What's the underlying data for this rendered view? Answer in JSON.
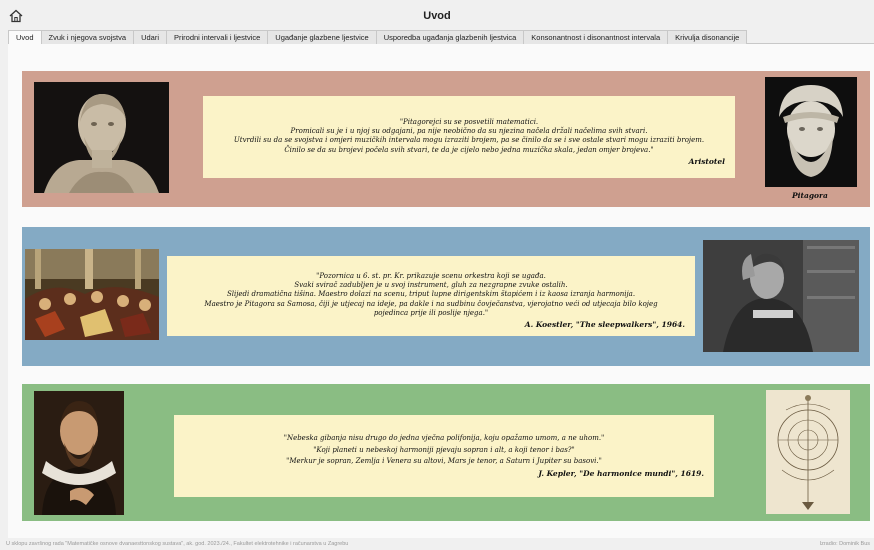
{
  "window": {
    "title": "Uvod"
  },
  "tabs": [
    {
      "label": "Uvod"
    },
    {
      "label": "Zvuk i njegova svojstva"
    },
    {
      "label": "Udari"
    },
    {
      "label": "Prirodni intervali i ljestvice"
    },
    {
      "label": "Ugađanje glazbene ljestvice"
    },
    {
      "label": "Usporedba ugađanja glazbenih ljestvica"
    },
    {
      "label": "Konsonantnost i disonantnost intervala"
    },
    {
      "label": "Krivulja disonancije"
    }
  ],
  "quotes": [
    {
      "lines": [
        "\"Pitagorejci su se posvetili matematici.",
        "Promicali su je i u njoj su odgajani, pa nije neobično da su njezina načela držali načelima svih stvari.",
        "Utvrdili su da se svojstva i omjeri muzičkih intervala mogu izraziti brojem, pa se činilo da se i sve ostale stvari mogu izraziti brojem.",
        "Činilo se da su brojevi počela svih stvari, te da je cijelo nebo jedna muzička skala, jedan omjer brojeva.\""
      ],
      "author": "Aristotel"
    },
    {
      "lines": [
        "\"Pozornica u 6. st. pr. Kr. prikazuje scenu orkestra koji se ugađa.",
        "Svaki svirač zadubljen je u svoj instrument, gluh za nezgrapne zvuke ostalih.",
        "Slijedi dramatična tišina. Maestro dolazi na scenu, triput lupne dirigentskim štapićem i iz kaosa izranja harmonija.",
        "Maestro je Pitagora sa Samosa, čiji je utjecaj na ideje, pa dakle i na sudbinu čovječanstva, vjerojatno veći od utjecaja bilo kojeg",
        "pojedinca prije ili poslije njega.\""
      ],
      "author": "A. Koestler, \"The sleepwalkers\", 1964."
    },
    {
      "lines": [
        "\"Nebeska gibanja nisu drugo do jedna vječna polifonija, koju opažamo umom, a ne uhom.\"",
        "\"Koji planeti u nebeskoj harmoniji pjevaju sopran i alt, a koji tenor i bas?\"",
        "\"Merkur je sopran, Zemlja i Venera su altovi, Mars je tenor, a Saturn i Jupiter su basovi.\""
      ],
      "author": "J. Kepler, \"De harmonice mundi\", 1619."
    }
  ],
  "captions": {
    "pythagoras": "Pitagora"
  },
  "footer": {
    "left": "U sklopu završnog rada \"Matematičke osnove dvanaesttonskog sustava\", ak. god. 2023./24., Fakultet elektrotehnike i računarstva u Zagrebu",
    "right": "Izradio: Dominik Bus"
  }
}
